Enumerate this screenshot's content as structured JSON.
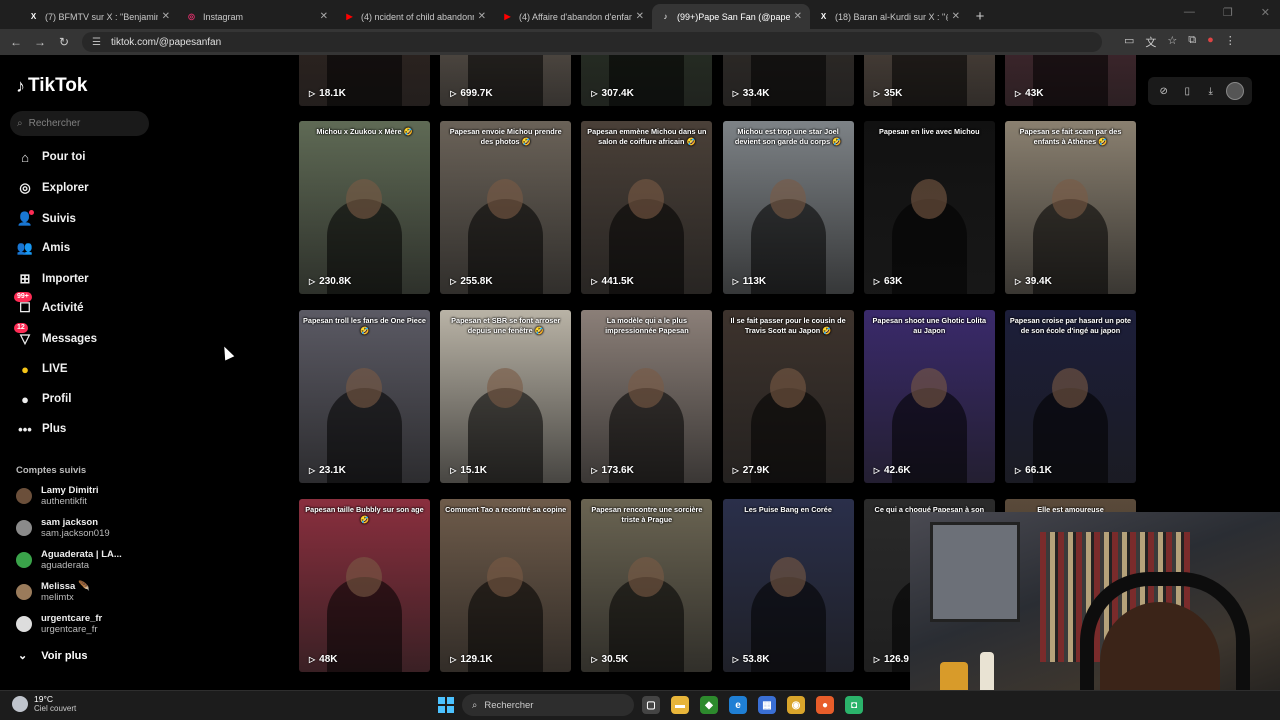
{
  "browser": {
    "tabs": [
      {
        "title": "(7) BFMTV sur X : \"Benjamin Ne",
        "icon": "x-logo-icon",
        "color": "#ffffff",
        "glyph": "X"
      },
      {
        "title": "Instagram",
        "icon": "instagram-icon",
        "color": "#e1306c",
        "glyph": "◎"
      },
      {
        "title": "(4) ncident of child abandonme",
        "icon": "youtube-icon",
        "color": "#ff0000",
        "glyph": "▶"
      },
      {
        "title": "(4) Affaire d'abandon d'enfants",
        "icon": "youtube-icon",
        "color": "#ff0000",
        "glyph": "▶"
      },
      {
        "title": "(99+)Pape San Fan (@papesanf",
        "icon": "tiktok-icon",
        "color": "#ffffff",
        "glyph": "♪",
        "active": true
      },
      {
        "title": "(18) Baran al-Kurdi sur X : \"@p",
        "icon": "x-logo-icon",
        "color": "#ffffff",
        "glyph": "X"
      }
    ],
    "url": "tiktok.com/@papesanfan"
  },
  "sidebar": {
    "logo": "TikTok",
    "search_placeholder": "Rechercher",
    "nav": [
      {
        "label": "Pour toi",
        "icon": "home-icon",
        "glyph": "⌂"
      },
      {
        "label": "Explorer",
        "icon": "compass-icon",
        "glyph": "◎"
      },
      {
        "label": "Suivis",
        "icon": "following-icon",
        "glyph": "👤"
      },
      {
        "label": "Amis",
        "icon": "friends-icon",
        "glyph": "👥"
      },
      {
        "label": "Importer",
        "icon": "upload-icon",
        "glyph": "⊞"
      },
      {
        "label": "Activité",
        "icon": "activity-icon",
        "glyph": "☐",
        "badge": "99+"
      },
      {
        "label": "Messages",
        "icon": "messages-icon",
        "glyph": "▽",
        "badge": "12"
      },
      {
        "label": "LIVE",
        "icon": "live-icon",
        "glyph": "●"
      },
      {
        "label": "Profil",
        "icon": "profile-icon",
        "glyph": "●"
      },
      {
        "label": "Plus",
        "icon": "more-icon",
        "glyph": "•••"
      }
    ],
    "followed_title": "Comptes suivis",
    "followed": [
      {
        "name": "Lamy Dimitri",
        "handle": "authentikfit",
        "color": "#6b4f3a"
      },
      {
        "name": "sam jackson",
        "handle": "sam.jackson019",
        "color": "#8a8a8a"
      },
      {
        "name": "Aguaderata | LA...",
        "handle": "aguaderata",
        "color": "#3aa34a"
      },
      {
        "name": "Melissa 🪶",
        "handle": "melimtx",
        "color": "#9a7b5b"
      },
      {
        "name": "urgentcare_fr",
        "handle": "urgentcare_fr",
        "color": "#dddddd"
      }
    ],
    "see_more": "Voir plus"
  },
  "videos": [
    {
      "caption": "",
      "views": "18.1K",
      "bg": "#3a2a24"
    },
    {
      "caption": "",
      "views": "699.7K",
      "bg": "#7b6f63"
    },
    {
      "caption": "",
      "views": "307.4K",
      "bg": "#2f3b2a"
    },
    {
      "caption": "",
      "views": "33.4K",
      "bg": "#3b3530"
    },
    {
      "caption": "",
      "views": "35K",
      "bg": "#6a5a4e"
    },
    {
      "caption": "",
      "views": "43K",
      "bg": "#5a2f3a"
    },
    {
      "caption": "Michou x Zuukou x Mère 🤣",
      "views": "230.8K",
      "bg": "#5f6a55"
    },
    {
      "caption": "Papesan envoie Michou prendre des photos 🤣",
      "views": "255.8K",
      "bg": "#6a6258"
    },
    {
      "caption": "Papesan emmène Michou dans un salon de coiffure africain 🤣",
      "views": "441.5K",
      "bg": "#4a4038"
    },
    {
      "caption": "Michou est trop une star Joel devient son garde du corps 🤣",
      "views": "113K",
      "bg": "#7d8286"
    },
    {
      "caption": "Papesan en live avec Michou",
      "views": "63K",
      "bg": "#111111"
    },
    {
      "caption": "Papesan se fait scam par des enfants à Athènes 🤣",
      "views": "39.4K",
      "bg": "#8a8070"
    },
    {
      "caption": "Papesan troll les fans de One Piece 🤣",
      "views": "23.1K",
      "bg": "#5b5a64"
    },
    {
      "caption": "Papesan et SBR se font arroser depuis une fenêtre 🤣",
      "views": "15.1K",
      "bg": "#b9b3a6"
    },
    {
      "caption": "La modèle qui a le plus impressionnée Papesan",
      "views": "173.6K",
      "bg": "#8b7f78"
    },
    {
      "caption": "Il se fait passer pour le cousin de Travis Scott au Japon 🤣",
      "views": "27.9K",
      "bg": "#3d332d"
    },
    {
      "caption": "Papesan shoot une Ghotic Lolita au Japon",
      "views": "42.6K",
      "bg": "#3a2a6b"
    },
    {
      "caption": "Papesan croise par hasard un pote de son école d'ingé au japon",
      "views": "66.1K",
      "bg": "#1c1e3a"
    },
    {
      "caption": "Papesan taille Bubbly sur son age 🤣",
      "views": "48K",
      "bg": "#8a2f3e"
    },
    {
      "caption": "Comment Tao a recontré sa copine",
      "views": "129.1K",
      "bg": "#6e5b4a"
    },
    {
      "caption": "Papesan rencontre une sorcière triste à Prague",
      "views": "30.5K",
      "bg": "#6a6452"
    },
    {
      "caption": "Les Puise Bang en Corée",
      "views": "53.8K",
      "bg": "#2a2f4a"
    },
    {
      "caption": "Ce qui a choqué Papesan à son",
      "views": "126.9",
      "bg": "#2a2a2a"
    },
    {
      "caption": "Elle est amoureuse",
      "views": "",
      "bg": "#5a4a3a"
    }
  ],
  "profile_actions": [
    "share-icon",
    "mobile-icon",
    "download-icon"
  ],
  "taskbar": {
    "temp": "19°C",
    "weather": "Ciel couvert",
    "search": "Rechercher",
    "apps": [
      {
        "name": "task-view-icon",
        "color": "#444",
        "glyph": "▢"
      },
      {
        "name": "file-explorer-icon",
        "color": "#e8b53a",
        "glyph": "▬"
      },
      {
        "name": "nvidia-icon",
        "color": "#2d8a2d",
        "glyph": "◆"
      },
      {
        "name": "edge-icon",
        "color": "#1f7fd4",
        "glyph": "e"
      },
      {
        "name": "store-icon",
        "color": "#3a6fd4",
        "glyph": "▦"
      },
      {
        "name": "chrome-icon",
        "color": "#d9a52b",
        "glyph": "◉"
      },
      {
        "name": "firefox-icon",
        "color": "#e85d2a",
        "glyph": "●"
      },
      {
        "name": "discord-icon",
        "color": "#2bb36b",
        "glyph": "◘"
      }
    ]
  }
}
